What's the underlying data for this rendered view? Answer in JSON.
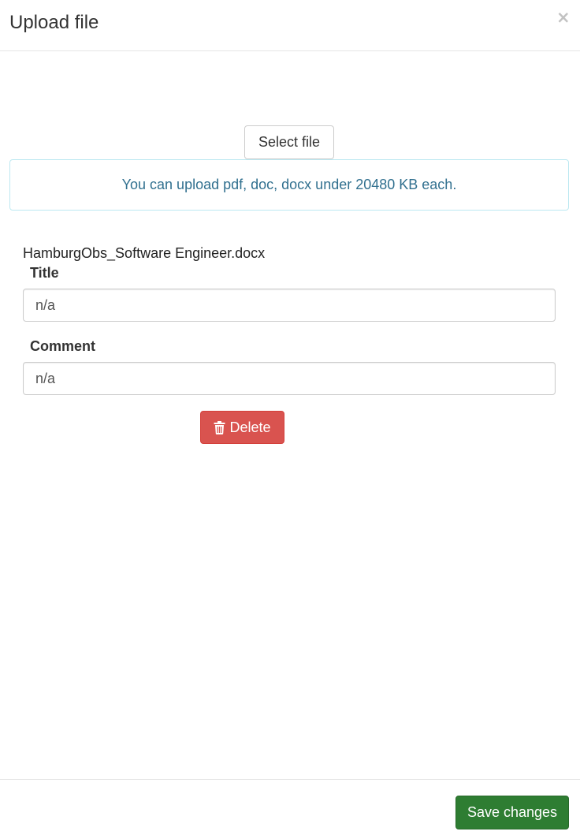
{
  "modal": {
    "title": "Upload file",
    "close_symbol": "×"
  },
  "upload": {
    "select_label": "Select file",
    "info_text": "You can upload pdf, doc, docx under 20480 KB each."
  },
  "file": {
    "name": "HamburgObs_Software Engineer.docx",
    "title_label": "Title",
    "title_value": "n/a",
    "comment_label": "Comment",
    "comment_value": "n/a",
    "delete_label": "Delete",
    "delete_icon": "trash-icon"
  },
  "footer": {
    "save_label": "Save changes"
  },
  "colors": {
    "info_text": "#31708f",
    "info_border": "#bce8f1",
    "delete_bg": "#d9534f",
    "save_bg": "#2e7d32"
  }
}
